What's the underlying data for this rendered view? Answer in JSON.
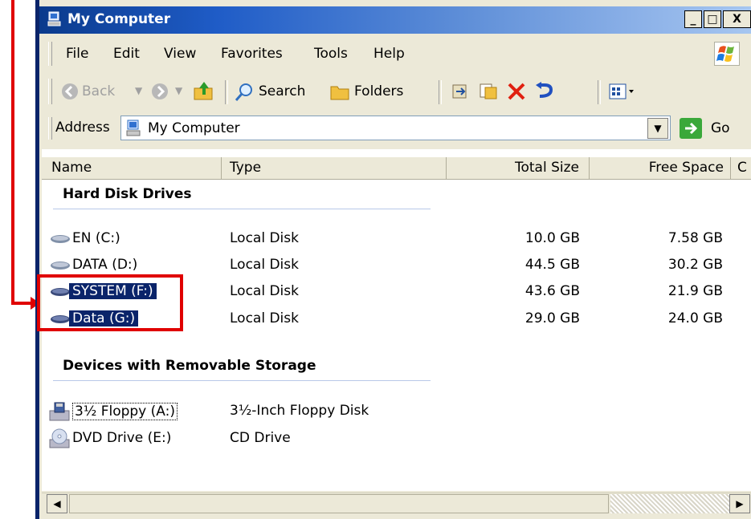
{
  "window": {
    "title": "My Computer"
  },
  "title_buttons": {
    "minimize": "_",
    "maximize": "□",
    "close": "X"
  },
  "menu": [
    "File",
    "Edit",
    "View",
    "Favorites",
    "Tools",
    "Help"
  ],
  "toolbar": {
    "back": "Back",
    "search": "Search",
    "folders": "Folders"
  },
  "address": {
    "label": "Address",
    "value": "My Computer",
    "go": "Go"
  },
  "columns": {
    "name": "Name",
    "type": "Type",
    "total": "Total Size",
    "free": "Free Space",
    "extra": "C"
  },
  "groups": {
    "hdd": {
      "title": "Hard Disk Drives",
      "rows": [
        {
          "name": "EN (C:)",
          "type": "Local Disk",
          "total": "10.0 GB",
          "free": "7.58 GB"
        },
        {
          "name": "DATA (D:)",
          "type": "Local Disk",
          "total": "44.5 GB",
          "free": "30.2 GB"
        },
        {
          "name": "SYSTEM (F:)",
          "type": "Local Disk",
          "total": "43.6 GB",
          "free": "21.9 GB"
        },
        {
          "name": "Data (G:)",
          "type": "Local Disk",
          "total": "29.0 GB",
          "free": "24.0 GB"
        }
      ]
    },
    "removable": {
      "title": "Devices with Removable Storage",
      "rows": [
        {
          "name": "3½ Floppy (A:)",
          "type": "3½-Inch Floppy Disk"
        },
        {
          "name": "DVD Drive (E:)",
          "type": "CD Drive"
        }
      ]
    }
  },
  "colors": {
    "selection": "#0a246a",
    "annotation": "#e00000",
    "titlebar": "#1f5cc7"
  }
}
